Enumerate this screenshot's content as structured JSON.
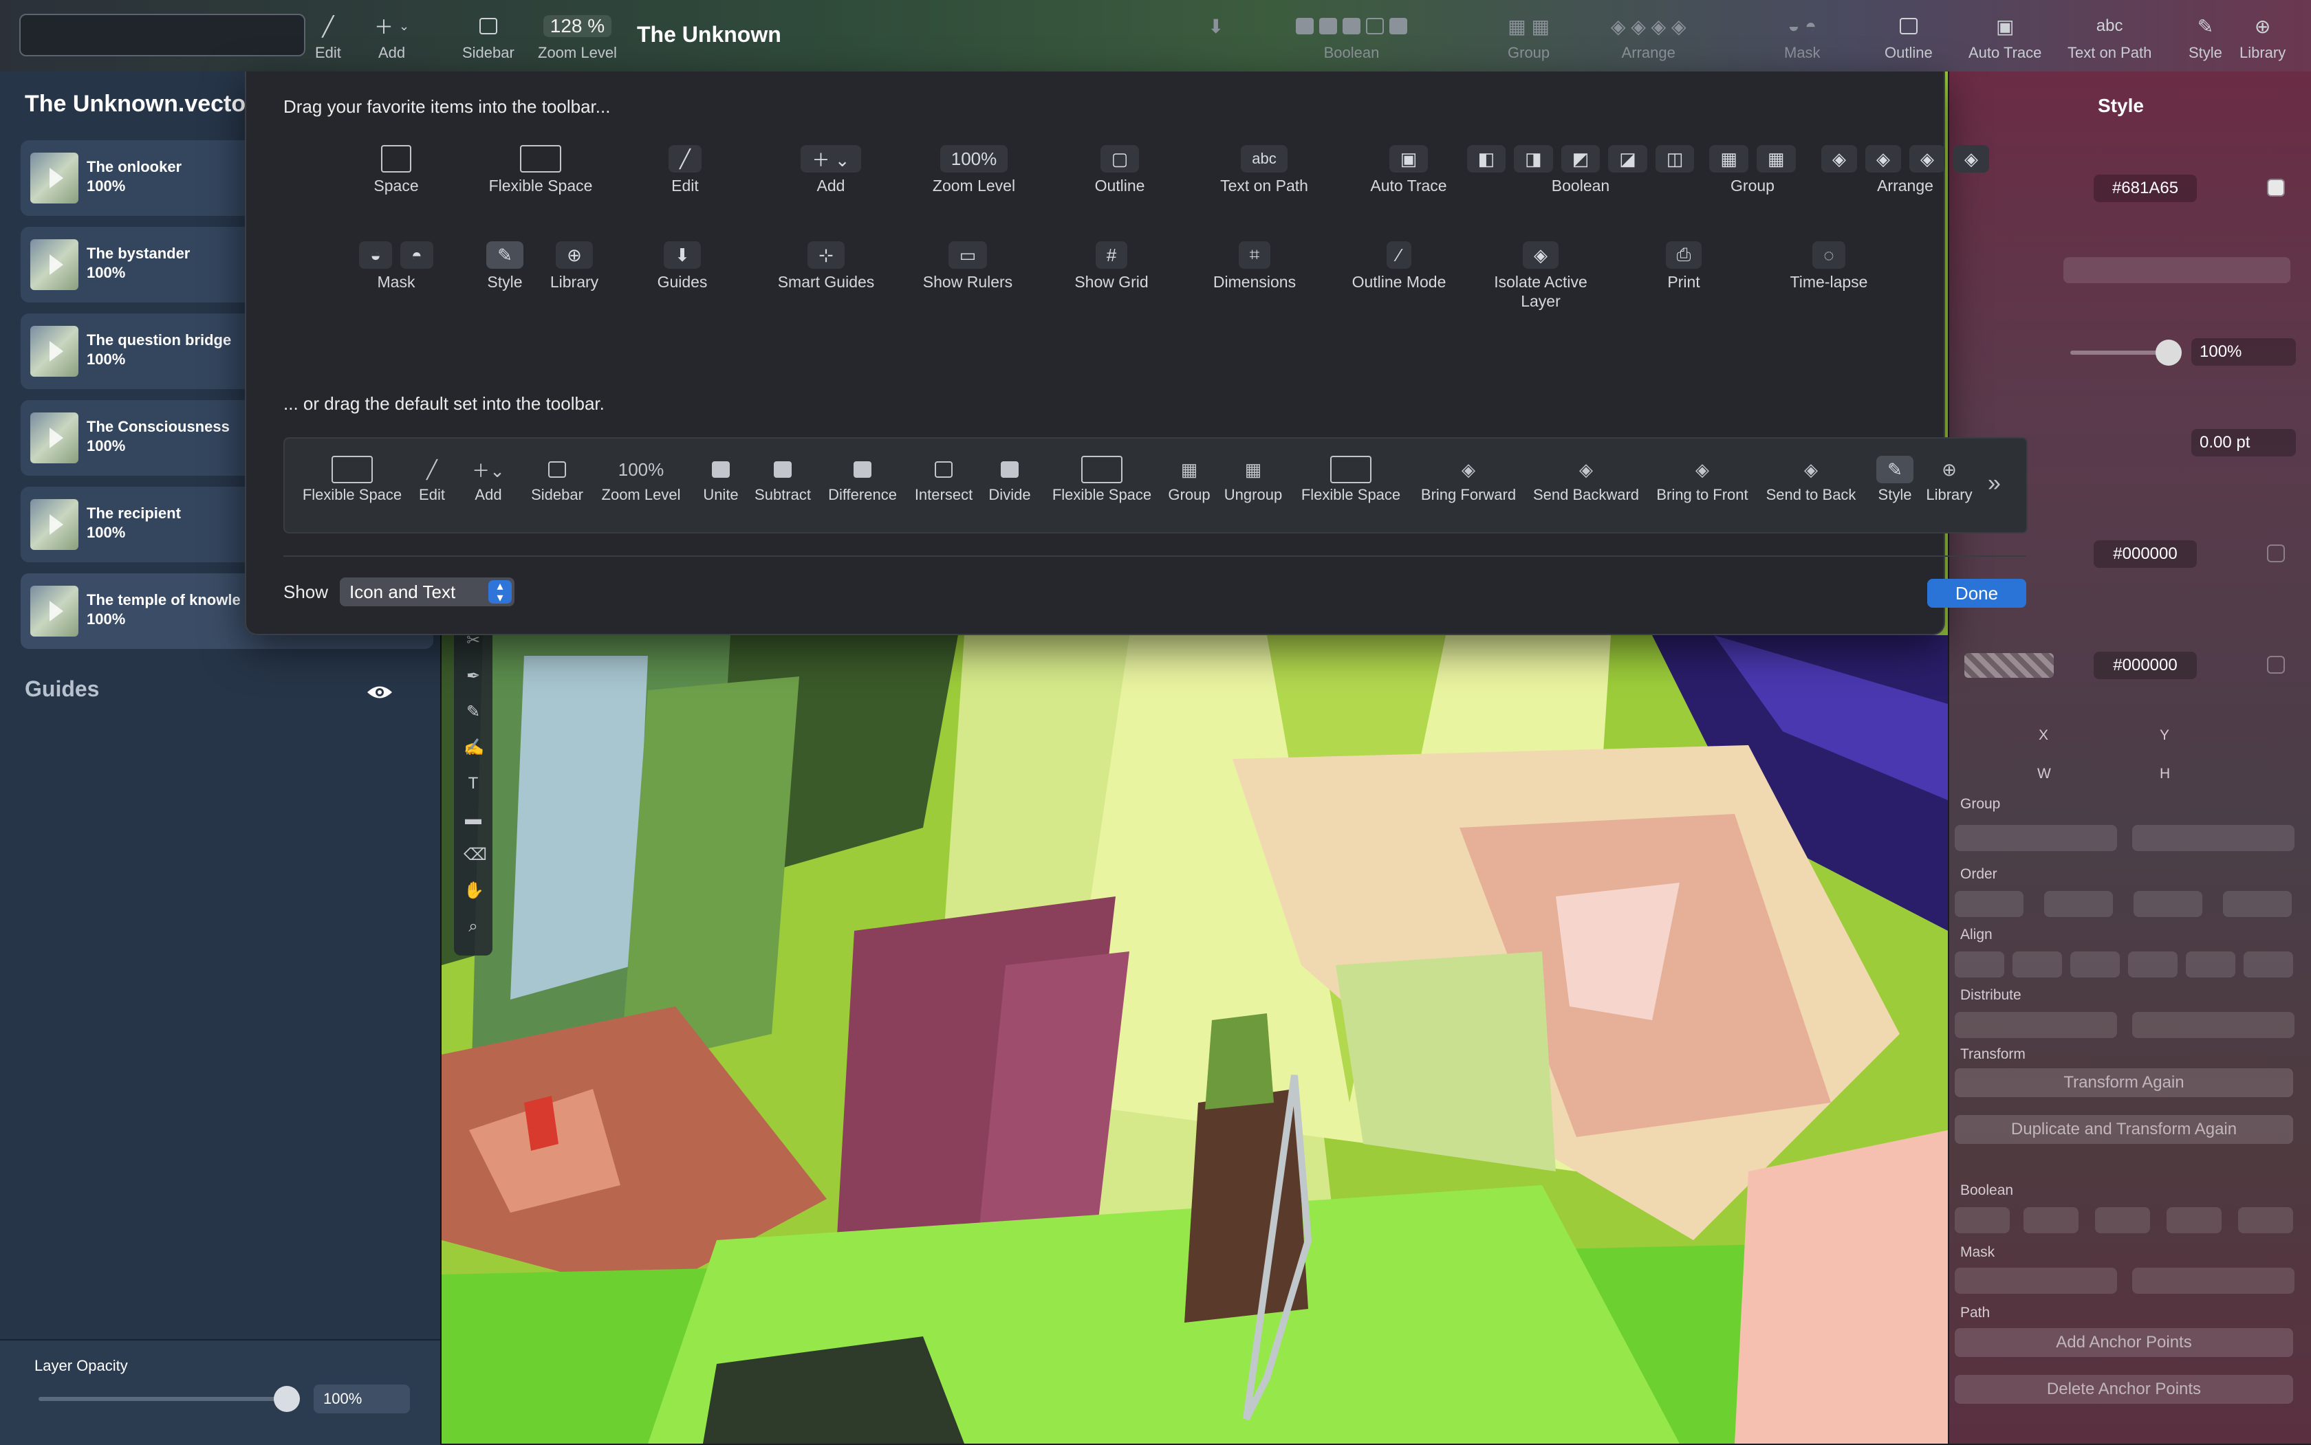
{
  "toolbar": {
    "edit": "Edit",
    "add": "Add",
    "sidebar": "Sidebar",
    "zoom_value": "128 %",
    "zoom_label": "Zoom Level",
    "title": "The Unknown",
    "boolean": "Boolean",
    "group": "Group",
    "arrange": "Arrange",
    "mask": "Mask",
    "outline": "Outline",
    "auto_trace": "Auto Trace",
    "text_on_path": "Text on Path",
    "text_on_path_icon_text": "abc",
    "style": "Style",
    "library": "Library"
  },
  "sidebar": {
    "doc_name": "The Unknown.vecto",
    "layers": [
      {
        "name": "The onlooker",
        "opacity": "100%"
      },
      {
        "name": "The bystander",
        "opacity": "100%"
      },
      {
        "name": "The question bridge",
        "opacity": "100%"
      },
      {
        "name": "The Consciousness",
        "opacity": "100%"
      },
      {
        "name": "The recipient",
        "opacity": "100%"
      },
      {
        "name": "The temple of knowle",
        "opacity": "100%"
      }
    ],
    "guides": "Guides",
    "layer_opacity_label": "Layer Opacity",
    "layer_opacity_value": "100%",
    "layer_opacity_fraction": 1.0
  },
  "sheet": {
    "heading": "Drag your favorite items into the toolbar...",
    "palette": [
      {
        "label": "Space",
        "icon": "space-icon"
      },
      {
        "label": "Flexible Space",
        "icon": "flexible-space-icon"
      },
      {
        "label": "Edit",
        "icon": "edit-icon"
      },
      {
        "label": "Add",
        "icon": "add-icon"
      },
      {
        "label": "Zoom Level",
        "icon": "zoom-level-icon",
        "value": "100%"
      },
      {
        "label": "Outline",
        "icon": "outline-icon"
      },
      {
        "label": "Text on Path",
        "icon": "text-on-path-icon",
        "value": "abc"
      },
      {
        "label": "Auto Trace",
        "icon": "auto-trace-icon"
      },
      {
        "label": "Boolean",
        "icon": "boolean-icon"
      },
      {
        "label": "Group",
        "icon": "group-icon"
      },
      {
        "label": "Arrange",
        "icon": "arrange-icon"
      },
      {
        "label": "Mask",
        "icon": "mask-icon"
      },
      {
        "label": "Style",
        "icon": "style-icon"
      },
      {
        "label": "Library",
        "icon": "library-icon"
      },
      {
        "label": "Guides",
        "icon": "guides-icon"
      },
      {
        "label": "Smart Guides",
        "icon": "smart-guides-icon"
      },
      {
        "label": "Show Rulers",
        "icon": "rulers-icon"
      },
      {
        "label": "Show Grid",
        "icon": "grid-icon"
      },
      {
        "label": "Dimensions",
        "icon": "dimensions-icon"
      },
      {
        "label": "Outline Mode",
        "icon": "outline-mode-icon"
      },
      {
        "label": "Isolate Active Layer",
        "icon": "isolate-layer-icon"
      },
      {
        "label": "Print",
        "icon": "print-icon"
      },
      {
        "label": "Time-lapse",
        "icon": "time-lapse-icon"
      }
    ],
    "default_heading": "... or drag the default set into the toolbar.",
    "default_set": [
      {
        "label": "Flexible Space"
      },
      {
        "label": "Edit"
      },
      {
        "label": "Add"
      },
      {
        "label": "Sidebar"
      },
      {
        "label": "Zoom Level",
        "value": "100%"
      },
      {
        "label": "Unite"
      },
      {
        "label": "Subtract"
      },
      {
        "label": "Difference"
      },
      {
        "label": "Intersect"
      },
      {
        "label": "Divide"
      },
      {
        "label": "Flexible Space"
      },
      {
        "label": "Group"
      },
      {
        "label": "Ungroup"
      },
      {
        "label": "Flexible Space"
      },
      {
        "label": "Bring Forward"
      },
      {
        "label": "Send Backward"
      },
      {
        "label": "Bring to Front"
      },
      {
        "label": "Send to Back"
      },
      {
        "label": "Style"
      },
      {
        "label": "Library"
      }
    ],
    "show_label": "Show",
    "show_value": "Icon and Text",
    "done": "Done"
  },
  "inspector": {
    "title": "Style",
    "fill_hex": "#681A65",
    "opacity_value": "100%",
    "stroke_width": "0.00 pt",
    "stroke_hex": "#000000",
    "shadow_hex": "#000000",
    "x_label": "X",
    "y_label": "Y",
    "w_label": "W",
    "h_label": "H",
    "group_label": "Group",
    "order_label": "Order",
    "align_label": "Align",
    "distribute_label": "Distribute",
    "transform_label": "Transform",
    "transform_again": "Transform Again",
    "duplicate_transform": "Duplicate and Transform Again",
    "boolean_label": "Boolean",
    "mask_label": "Mask",
    "path_label": "Path",
    "add_anchor": "Add Anchor Points",
    "delete_anchor": "Delete Anchor Points"
  },
  "colors": {
    "accent": "#2A74D8",
    "fill_swatch": "#681A65",
    "sidebar_bg": "#263548",
    "sheet_bg": "#25272C"
  }
}
